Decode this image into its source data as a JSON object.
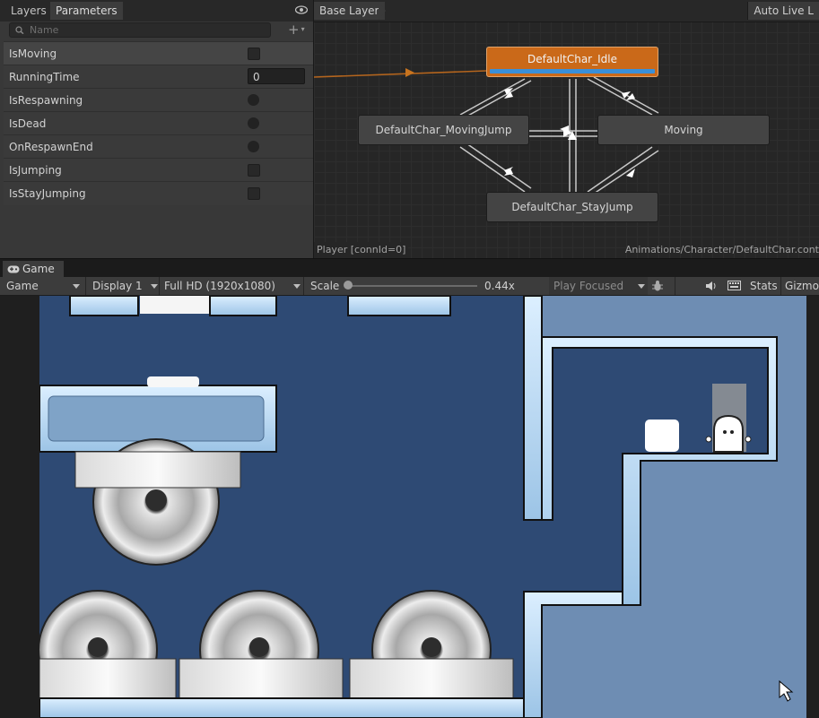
{
  "animator": {
    "tabs": [
      "Layers",
      "Parameters"
    ],
    "active_tab": "Parameters",
    "search_placeholder": "Name",
    "add_label": "+",
    "parameters": [
      {
        "name": "IsMoving",
        "type": "bool",
        "value": false
      },
      {
        "name": "RunningTime",
        "type": "float",
        "value": "0"
      },
      {
        "name": "IsRespawning",
        "type": "trigger"
      },
      {
        "name": "IsDead",
        "type": "trigger"
      },
      {
        "name": "OnRespawnEnd",
        "type": "trigger"
      },
      {
        "name": "IsJumping",
        "type": "bool",
        "value": false
      },
      {
        "name": "IsStayJumping",
        "type": "bool",
        "value": false
      }
    ],
    "breadcrumb": "Base Layer",
    "auto_live": "Auto Live L",
    "states": {
      "idle": "DefaultChar_Idle",
      "moving_jump": "DefaultChar_MovingJump",
      "moving": "Moving",
      "stay_jump": "DefaultChar_StayJump"
    },
    "idle_progress": 1.0,
    "footer_left": "Player [connId=0]",
    "footer_right": "Animations/Character/DefaultChar.cont",
    "colors": {
      "default_state": "#ca6919",
      "progress": "#3a8fd8",
      "entry_line": "#b5651d"
    }
  },
  "game": {
    "tab_label": "Game",
    "view_mode": "Game",
    "display": "Display 1",
    "resolution": "Full HD (1920x1080)",
    "scale_label": "Scale",
    "scale_value": "0.44x",
    "play_mode": "Play Focused",
    "stats_label": "Stats",
    "gizmos_label": "Gizmo",
    "icons": [
      "gamepad-icon",
      "bug-icon",
      "audio-icon",
      "keyboard-icon"
    ]
  }
}
